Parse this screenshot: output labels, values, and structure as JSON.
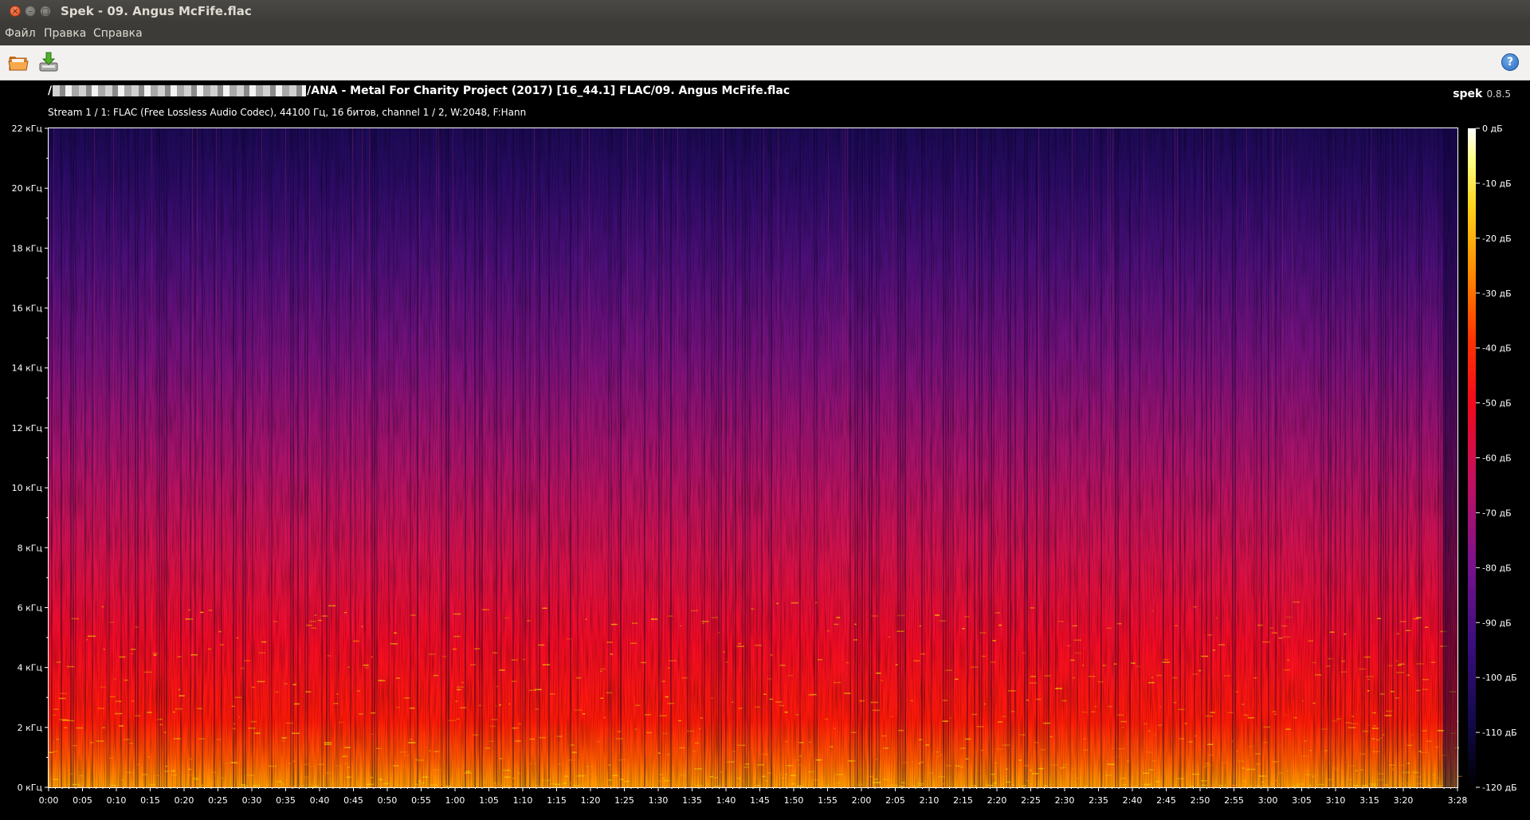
{
  "window": {
    "title": "Spek - 09. Angus McFife.flac",
    "close_glyph": "×",
    "min_glyph": "–",
    "max_glyph": "□"
  },
  "menu": {
    "items": [
      "Файл",
      "Правка",
      "Справка"
    ]
  },
  "toolbar": {
    "open_icon": "folder-open-icon",
    "save_icon": "save-download-icon",
    "help_icon": "help-icon",
    "help_glyph": "?"
  },
  "header": {
    "path_prefix": "/",
    "path_suffix": "/ANA - Metal For Charity Project (2017) [16_44.1] FLAC/09. Angus McFife.flac",
    "brand_name": "spek",
    "brand_version": "0.8.5",
    "stream_info": "Stream 1 / 1: FLAC (Free Lossless Audio Codec), 44100 Гц, 16 битов, channel 1 / 2, W:2048, F:Hann"
  },
  "chart_data": {
    "type": "heatmap",
    "x_unit": "time",
    "x_range_seconds": [
      0,
      208
    ],
    "x_ticks": [
      "0:00",
      "0:05",
      "0:10",
      "0:15",
      "0:20",
      "0:25",
      "0:30",
      "0:35",
      "0:40",
      "0:45",
      "0:50",
      "0:55",
      "1:00",
      "1:05",
      "1:10",
      "1:15",
      "1:20",
      "1:25",
      "1:30",
      "1:35",
      "1:40",
      "1:45",
      "1:50",
      "1:55",
      "2:00",
      "2:05",
      "2:10",
      "2:15",
      "2:20",
      "2:25",
      "2:30",
      "2:35",
      "2:40",
      "2:45",
      "2:50",
      "2:55",
      "3:00",
      "3:05",
      "3:10",
      "3:15",
      "3:20"
    ],
    "x_end_label": "3:28",
    "y_unit": "kHz",
    "y_range_khz": [
      0,
      22
    ],
    "y_ticks": [
      "0 кГц",
      "2 кГц",
      "4 кГц",
      "6 кГц",
      "8 кГц",
      "10 кГц",
      "12 кГц",
      "14 кГц",
      "16 кГц",
      "18 кГц",
      "20 кГц",
      "22 кГц"
    ],
    "colorbar_range_db": [
      -120,
      0
    ],
    "colorbar_ticks": [
      "0 дБ",
      "-10 дБ",
      "-20 дБ",
      "-30 дБ",
      "-40 дБ",
      "-50 дБ",
      "-60 дБ",
      "-70 дБ",
      "-80 дБ",
      "-90 дБ",
      "-100 дБ",
      "-110 дБ",
      "-120 дБ"
    ],
    "colormap": [
      "#000000",
      "#1a0a5e",
      "#5b0f8a",
      "#a3148f",
      "#e0104a",
      "#ff0c0c",
      "#ff6a00",
      "#ffc400",
      "#ffff70",
      "#ffffff"
    ]
  }
}
